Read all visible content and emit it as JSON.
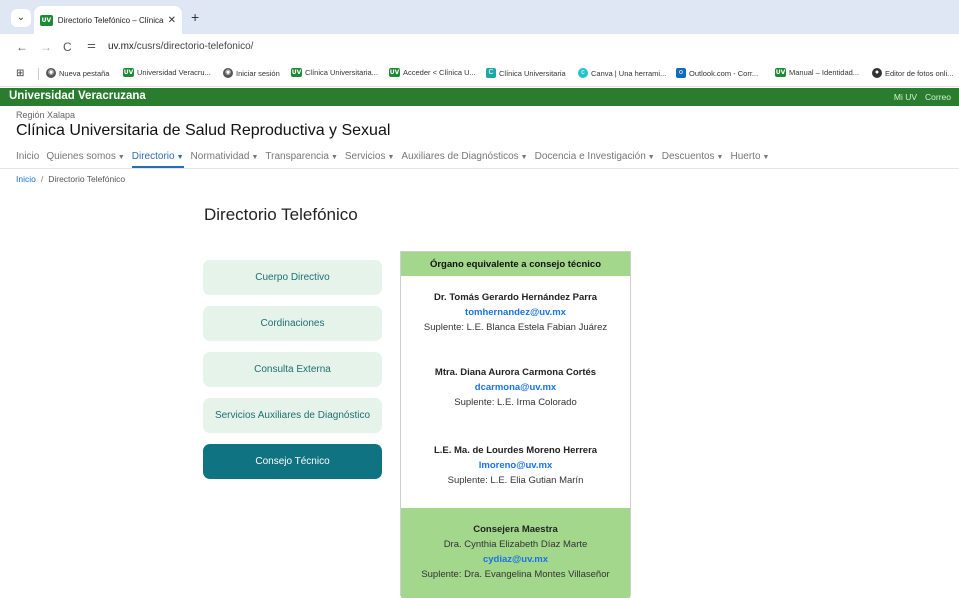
{
  "browser": {
    "tab_title": "Directorio Telefónico – Clínica U",
    "favicon_text": "UV",
    "url_domain": "uv.mx",
    "url_path": "/cusrs/directorio-telefonico/",
    "bookmarks": [
      {
        "label": "Nueva pestaña",
        "icon": "chrome-icon"
      },
      {
        "label": "Universidad Veracru...",
        "icon": "uv-favicon"
      },
      {
        "label": "Iniciar sesión",
        "icon": "chrome-icon"
      },
      {
        "label": "Clínica Universitaria...",
        "icon": "uv-favicon"
      },
      {
        "label": "Acceder < Clínica U...",
        "icon": "uv-favicon"
      },
      {
        "label": "Clínica Universitaria",
        "icon": "c-favicon"
      },
      {
        "label": "Canva | Una herrami...",
        "icon": "canva-icon"
      },
      {
        "label": "Outlook.com - Corr...",
        "icon": "outlook-icon"
      },
      {
        "label": "Manual – Identidad...",
        "icon": "uv-favicon"
      },
      {
        "label": "Editor de fotos onli...",
        "icon": "photo-editor-icon"
      }
    ]
  },
  "header": {
    "brand": "Universidad Veracruzana",
    "links": [
      "Mi UV",
      "Correo"
    ],
    "region": "Región Xalapa",
    "title": "Clínica Universitaria de Salud Reproductiva y Sexual"
  },
  "nav": [
    {
      "label": "Inicio",
      "dropdown": false
    },
    {
      "label": "Quienes somos",
      "dropdown": true
    },
    {
      "label": "Directorio",
      "dropdown": true,
      "active": true
    },
    {
      "label": "Normatividad",
      "dropdown": true
    },
    {
      "label": "Transparencia",
      "dropdown": true
    },
    {
      "label": "Servicios",
      "dropdown": true
    },
    {
      "label": "Auxiliares de Diagnósticos",
      "dropdown": true
    },
    {
      "label": "Docencia e Investigación",
      "dropdown": true
    },
    {
      "label": "Descuentos",
      "dropdown": true
    },
    {
      "label": "Huerto",
      "dropdown": true
    }
  ],
  "breadcrumb": {
    "home": "Inicio",
    "current": "Directorio Telefónico"
  },
  "page_title": "Directorio Telefónico",
  "sidebar": [
    {
      "label": "Cuerpo Directivo"
    },
    {
      "label": "Cordinaciones"
    },
    {
      "label": "Consulta Externa"
    },
    {
      "label": "Servicios Auxiliares de Diagnóstico"
    },
    {
      "label": "Consejo Técnico",
      "active": true
    }
  ],
  "card": {
    "heading": "Órgano equivalente a consejo técnico",
    "members": [
      {
        "name": "Dr. Tomás Gerardo Hernández Parra",
        "email": "tomhernandez@uv.mx",
        "suplente": "Suplente: L.E. Blanca Estela Fabian Juárez"
      },
      {
        "name": "Mtra. Diana Aurora Carmona Cortés",
        "email": "dcarmona@uv.mx",
        "suplente": "Suplente: L.E. Irma Colorado"
      },
      {
        "name": "L.E. Ma. de Lourdes Moreno Herrera",
        "email": "lmoreno@uv.mx",
        "suplente": "Suplente: L.E. Elia Gutian Marín"
      }
    ],
    "lead": {
      "role": "Consejera Maestra",
      "name": "Dra. Cynthia Elizabeth Díaz Marte",
      "email": "cydiaz@uv.mx",
      "suplente": "Suplente: Dra. Evangelina Montes Villaseñor"
    }
  },
  "colors": {
    "uv_green": "#2a7d2e",
    "teal_active": "#0f7381",
    "light_green": "#a3d78c",
    "link_blue": "#1a73e8"
  }
}
